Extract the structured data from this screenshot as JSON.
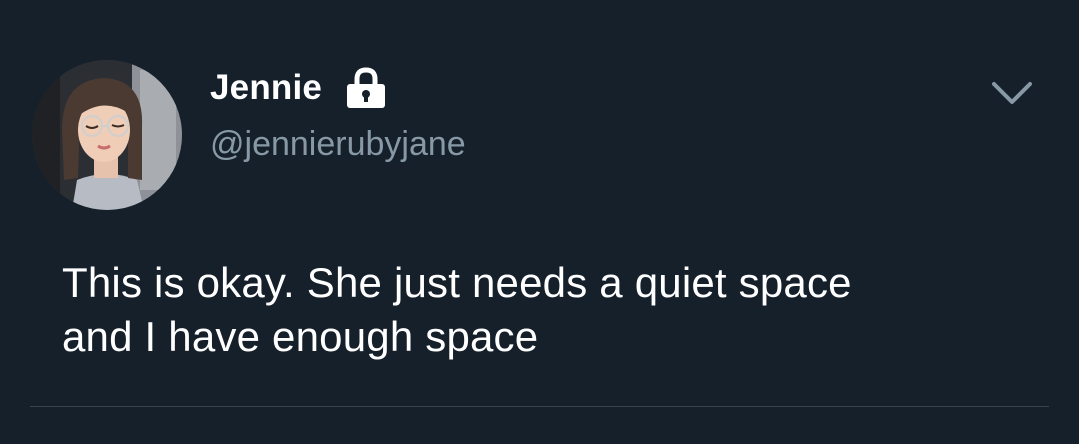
{
  "tweet": {
    "author": {
      "display_name": "Jennie",
      "handle": "@jennierubyjane",
      "protected_icon": "lock-icon"
    },
    "menu_icon": "chevron-down-icon",
    "text_line_1": "This is okay. She just needs a quiet space",
    "text_line_2": "and I have enough space"
  },
  "colors": {
    "background": "#15202b",
    "primary_text": "#ffffff",
    "secondary_text": "#8899a6",
    "divider": "#38444d"
  }
}
